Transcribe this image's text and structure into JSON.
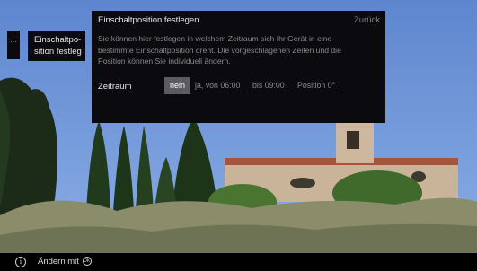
{
  "sidebar": {
    "strip_label": "...",
    "current_item": "Einschaltpo-\nsition festleg"
  },
  "dialog": {
    "title": "Einschaltposition festlegen",
    "back_label": "Zurück",
    "description": "Sie können hier festlegen in welchem Zeitraum sich Ihr Gerät in eine bestimmte Einschaltposition dreht. Die vorgeschlagenen Zeiten und die Position können Sie individuell ändern.",
    "row_label": "Zeitraum",
    "options": {
      "nein": "nein",
      "ja_von": "ja, von  06:00",
      "bis": "bis  09:00",
      "position": "Position 0°"
    },
    "selected": "nein"
  },
  "footer": {
    "hint": "Ändern mit",
    "icons": [
      "info-icon",
      "ok-icon"
    ]
  },
  "colors": {
    "panel": "#0b0b0f",
    "selected_option": "#5c5c60",
    "text_primary": "#e6e6e6",
    "text_secondary": "#8a8a8a"
  }
}
